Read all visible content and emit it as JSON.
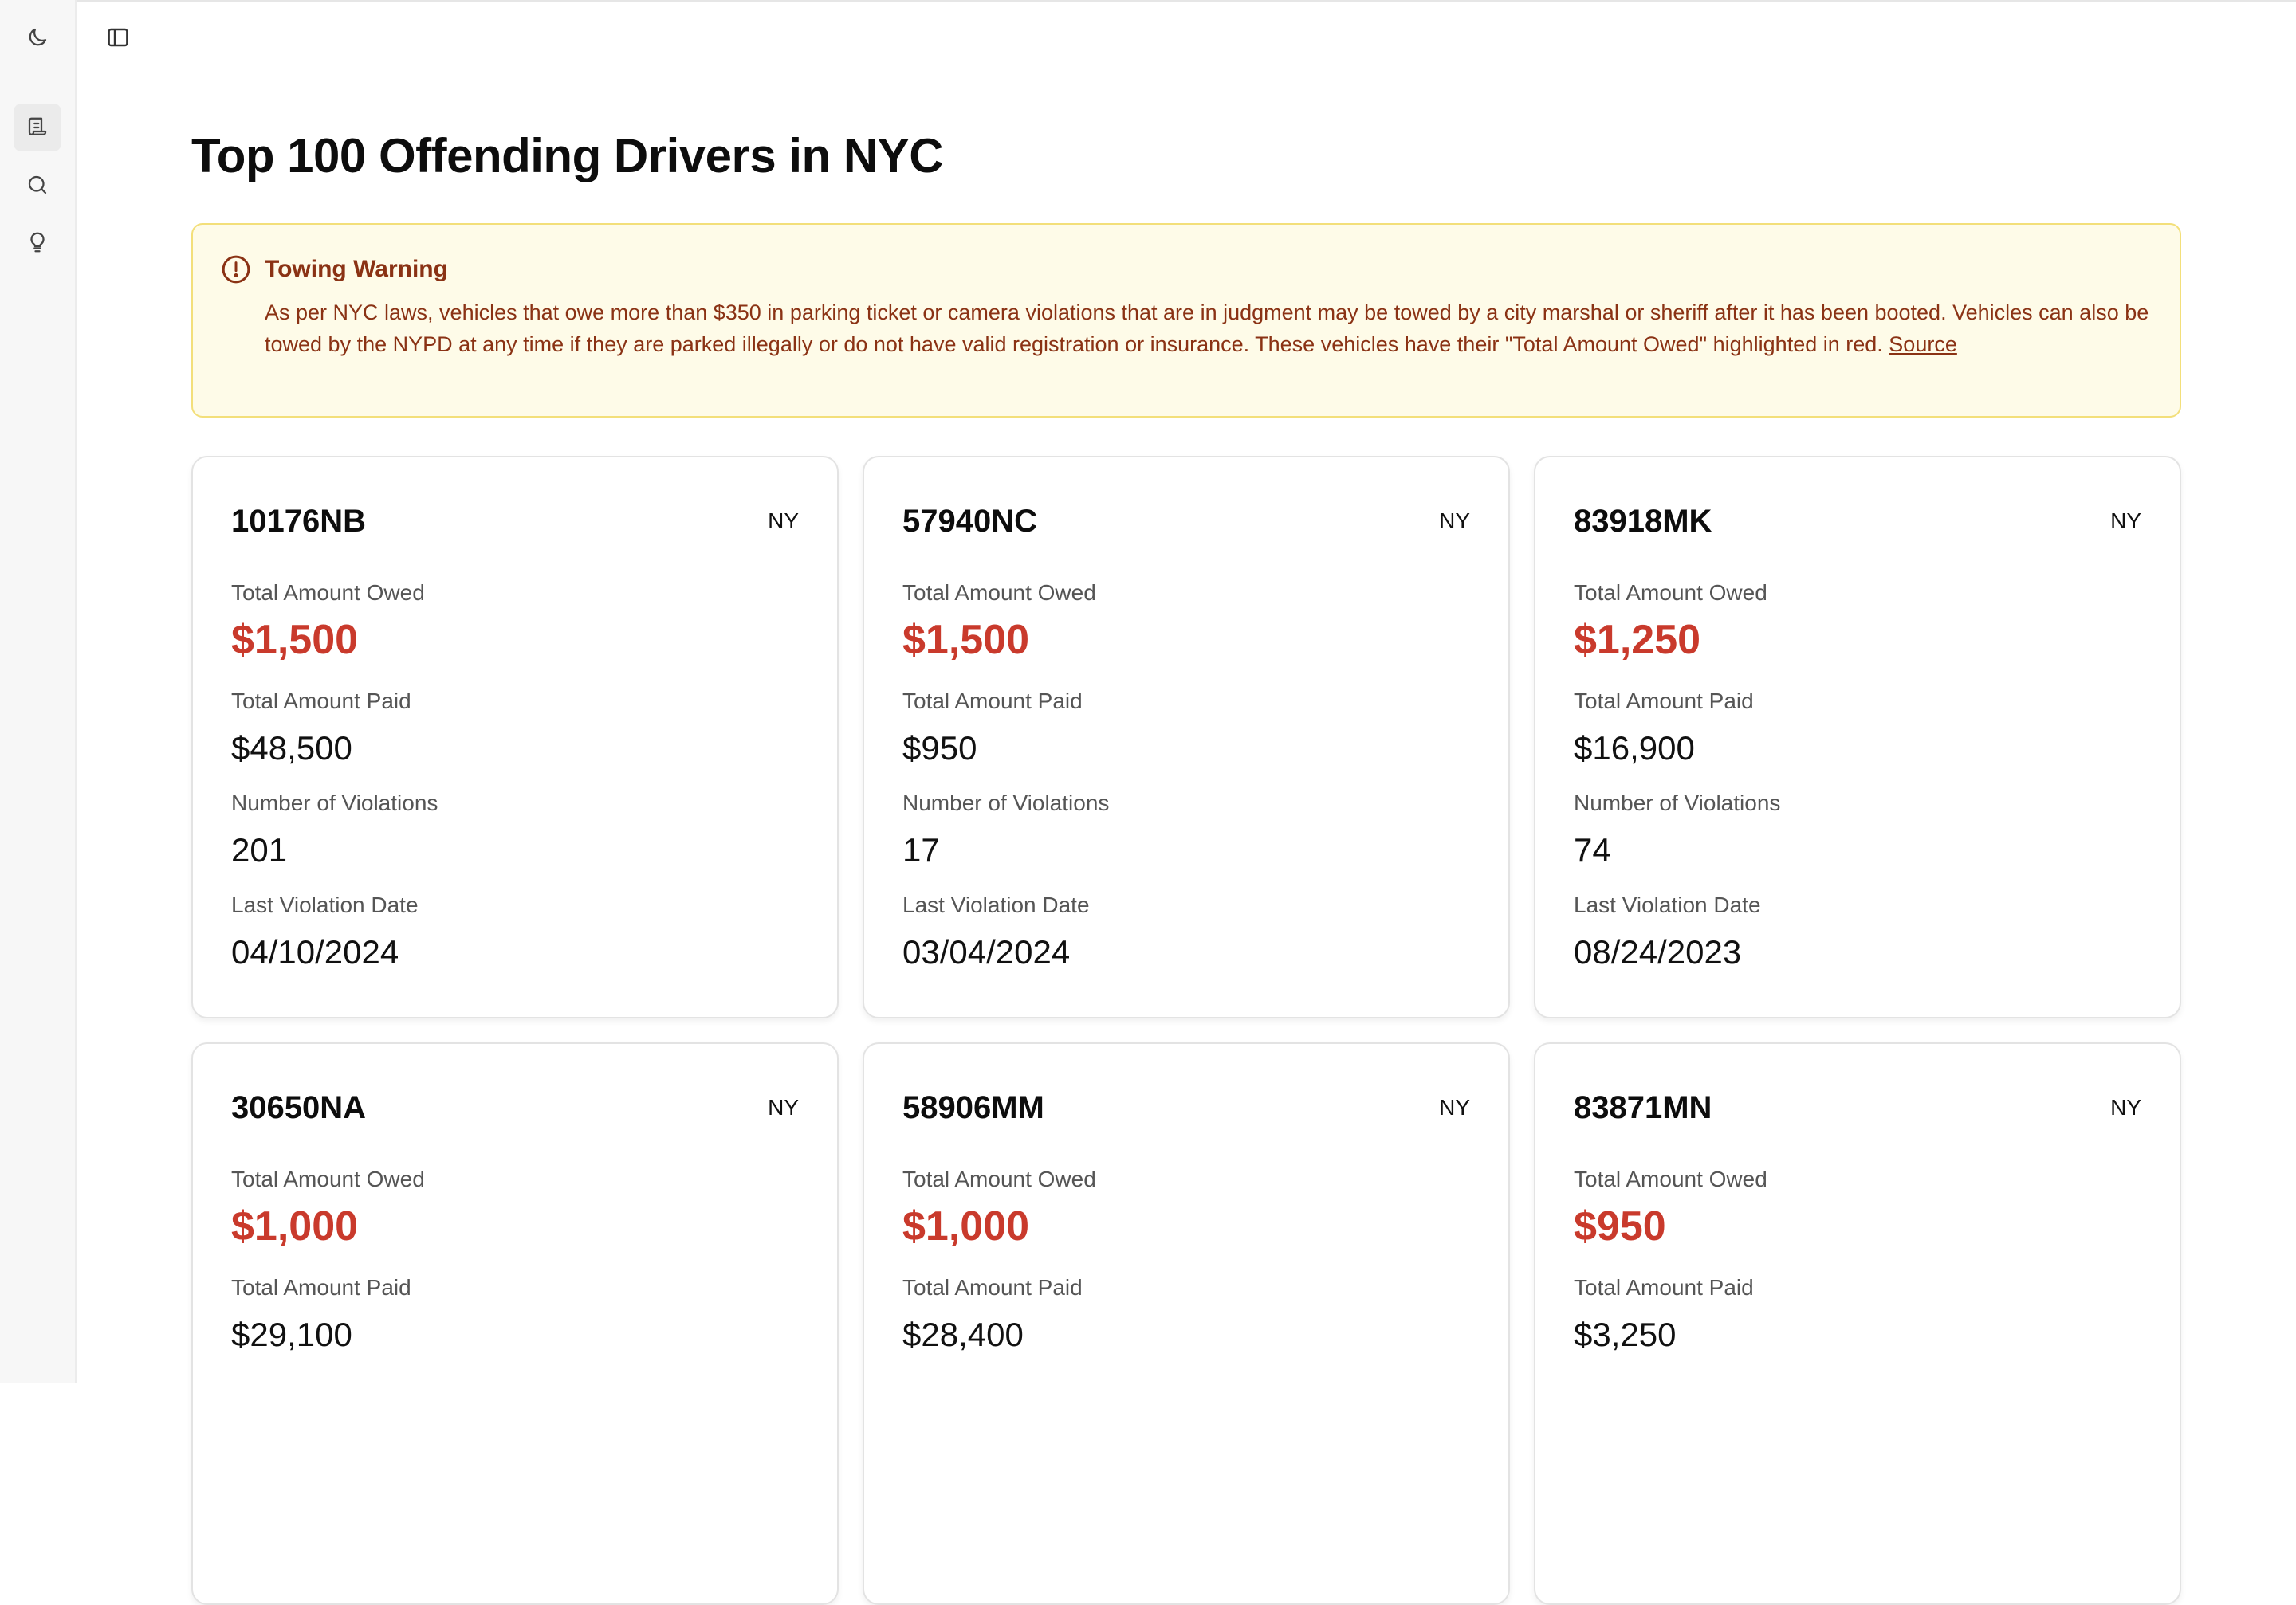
{
  "icons": {
    "theme": "moon-icon",
    "sidebar_toggle": "sidebar-panel-icon",
    "nav": [
      "scroll-list-icon",
      "search-icon",
      "lightbulb-icon"
    ],
    "alert": "alert-circle-icon"
  },
  "colors": {
    "owed": "#c93a2c",
    "alert_bg": "#fefbe8",
    "alert_border": "#f3df7a",
    "alert_text": "#8a3214"
  },
  "page": {
    "title": "Top 100 Offending Drivers in NYC"
  },
  "alert": {
    "title": "Towing Warning",
    "body": "As per NYC laws, vehicles that owe more than $350 in parking ticket or camera violations that are in judgment may be towed by a city marshal or sheriff after it has been booted. Vehicles can also be towed by the NYPD at any time if they are parked illegally or do not have valid registration or insurance. These vehicles have their \"Total Amount Owed\" highlighted in red.",
    "link": "Source"
  },
  "labels": {
    "owed": "Total Amount Owed",
    "paid": "Total Amount Paid",
    "violations": "Number of Violations",
    "last_date": "Last Violation Date"
  },
  "cards": [
    {
      "plate": "10176NB",
      "state": "NY",
      "owed": "$1,500",
      "paid": "$48,500",
      "violations": "201",
      "last_date": "04/10/2024"
    },
    {
      "plate": "57940NC",
      "state": "NY",
      "owed": "$1,500",
      "paid": "$950",
      "violations": "17",
      "last_date": "03/04/2024"
    },
    {
      "plate": "83918MK",
      "state": "NY",
      "owed": "$1,250",
      "paid": "$16,900",
      "violations": "74",
      "last_date": "08/24/2023"
    },
    {
      "plate": "30650NA",
      "state": "NY",
      "owed": "$1,000",
      "paid": "$29,100"
    },
    {
      "plate": "58906MM",
      "state": "NY",
      "owed": "$1,000",
      "paid": "$28,400"
    },
    {
      "plate": "83871MN",
      "state": "NY",
      "owed": "$950",
      "paid": "$3,250"
    }
  ]
}
